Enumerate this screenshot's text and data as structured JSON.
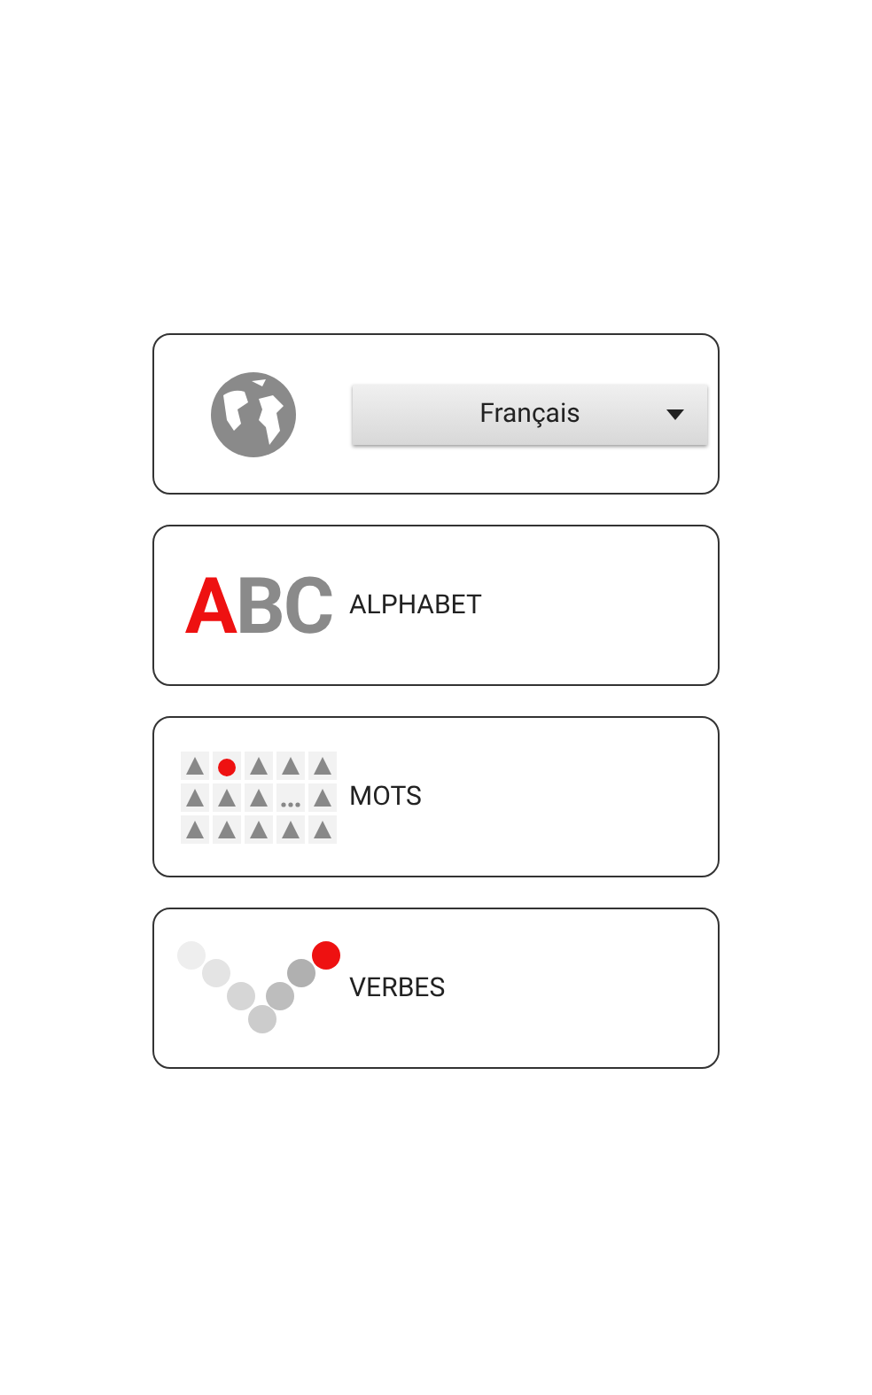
{
  "language_card": {
    "dropdown": {
      "value": "Français"
    }
  },
  "menu": [
    {
      "kind": "alphabet",
      "label": "ALPHABET",
      "logo": [
        {
          "text": "A",
          "color": "#ee1111"
        },
        {
          "text": "BC",
          "color": "#8a8a8a"
        }
      ]
    },
    {
      "kind": "words",
      "label": "MOTS"
    },
    {
      "kind": "verbs",
      "label": "VERBES"
    }
  ]
}
